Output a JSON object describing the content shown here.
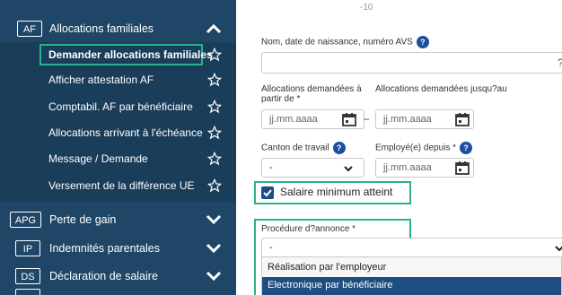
{
  "sidebar": {
    "sections_top": [
      {
        "badge": "AF",
        "label": "Allocations familiales",
        "expanded": true
      }
    ],
    "sub_items": [
      {
        "label": "Demander allocations familiales",
        "active": true
      },
      {
        "label": "Afficher attestation AF"
      },
      {
        "label": "Comptabil. AF par bénéficiaire"
      },
      {
        "label": "Allocations arrivant à l'échéance"
      },
      {
        "label": "Message / Demande"
      },
      {
        "label": "Versement de la différence UE"
      }
    ],
    "sections_bottom": [
      {
        "badge": "APG",
        "label": "Perte de gain"
      },
      {
        "badge": "IP",
        "label": "Indemnités parentales"
      },
      {
        "badge": "DS",
        "label": "Déclaration de salaire"
      }
    ]
  },
  "form": {
    "top_fragment": "-10",
    "name_label": "Nom, date de naissance, numéro AVS",
    "name_value": "",
    "name_help": "?",
    "alloc_from_label": "Allocations demandées à partir de *",
    "alloc_until_label": "Allocations demandées jusqu?au",
    "date_placeholder": "jj.mm.aaaa",
    "dash": "–",
    "canton_label": "Canton de travail",
    "canton_value": "-",
    "employed_since_label": "Employé(e) depuis *",
    "checkbox_label": "Salaire minimum atteint",
    "procedure_label": "Procédure d?annonce *",
    "procedure_value": "-",
    "options": [
      "Réalisation par l'employeur",
      "Electronique par bénéficiaire"
    ]
  },
  "colors": {
    "sidebar_bg": "#1f4666",
    "subnav_bg": "#1a3d5a",
    "highlight": "#29b38d",
    "help_blue": "#1d4ea0",
    "selected_option_bg": "#1d4e7f"
  }
}
